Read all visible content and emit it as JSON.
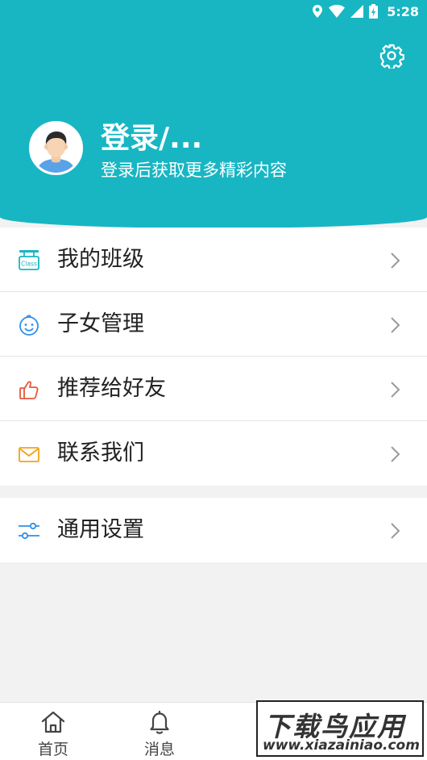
{
  "status_bar": {
    "time": "5:28",
    "icons": [
      "location-icon",
      "wifi-icon",
      "signal-icon",
      "battery-icon"
    ]
  },
  "header": {
    "settings_icon": "gear-icon",
    "login_title": "登录/...",
    "login_subtitle": "登录后获取更多精彩内容",
    "background_color": "#18b6c3"
  },
  "menu_primary": [
    {
      "label": "我的班级",
      "icon": "class-icon",
      "icon_color": "#18b6c3"
    },
    {
      "label": "子女管理",
      "icon": "baby-face-icon",
      "icon_color": "#2f8fe8"
    },
    {
      "label": "推荐给好友",
      "icon": "thumbs-up-icon",
      "icon_color": "#e5573a"
    },
    {
      "label": "联系我们",
      "icon": "mail-icon",
      "icon_color": "#f2a21b"
    }
  ],
  "menu_secondary": [
    {
      "label": "通用设置",
      "icon": "sliders-icon",
      "icon_color": "#2f8fe8"
    }
  ],
  "tab_bar": [
    {
      "label": "首页",
      "icon": "home-icon"
    },
    {
      "label": "消息",
      "icon": "bell-icon"
    }
  ],
  "watermark": {
    "title": "下载鸟应用",
    "url": "www.xiazainiao.com"
  }
}
